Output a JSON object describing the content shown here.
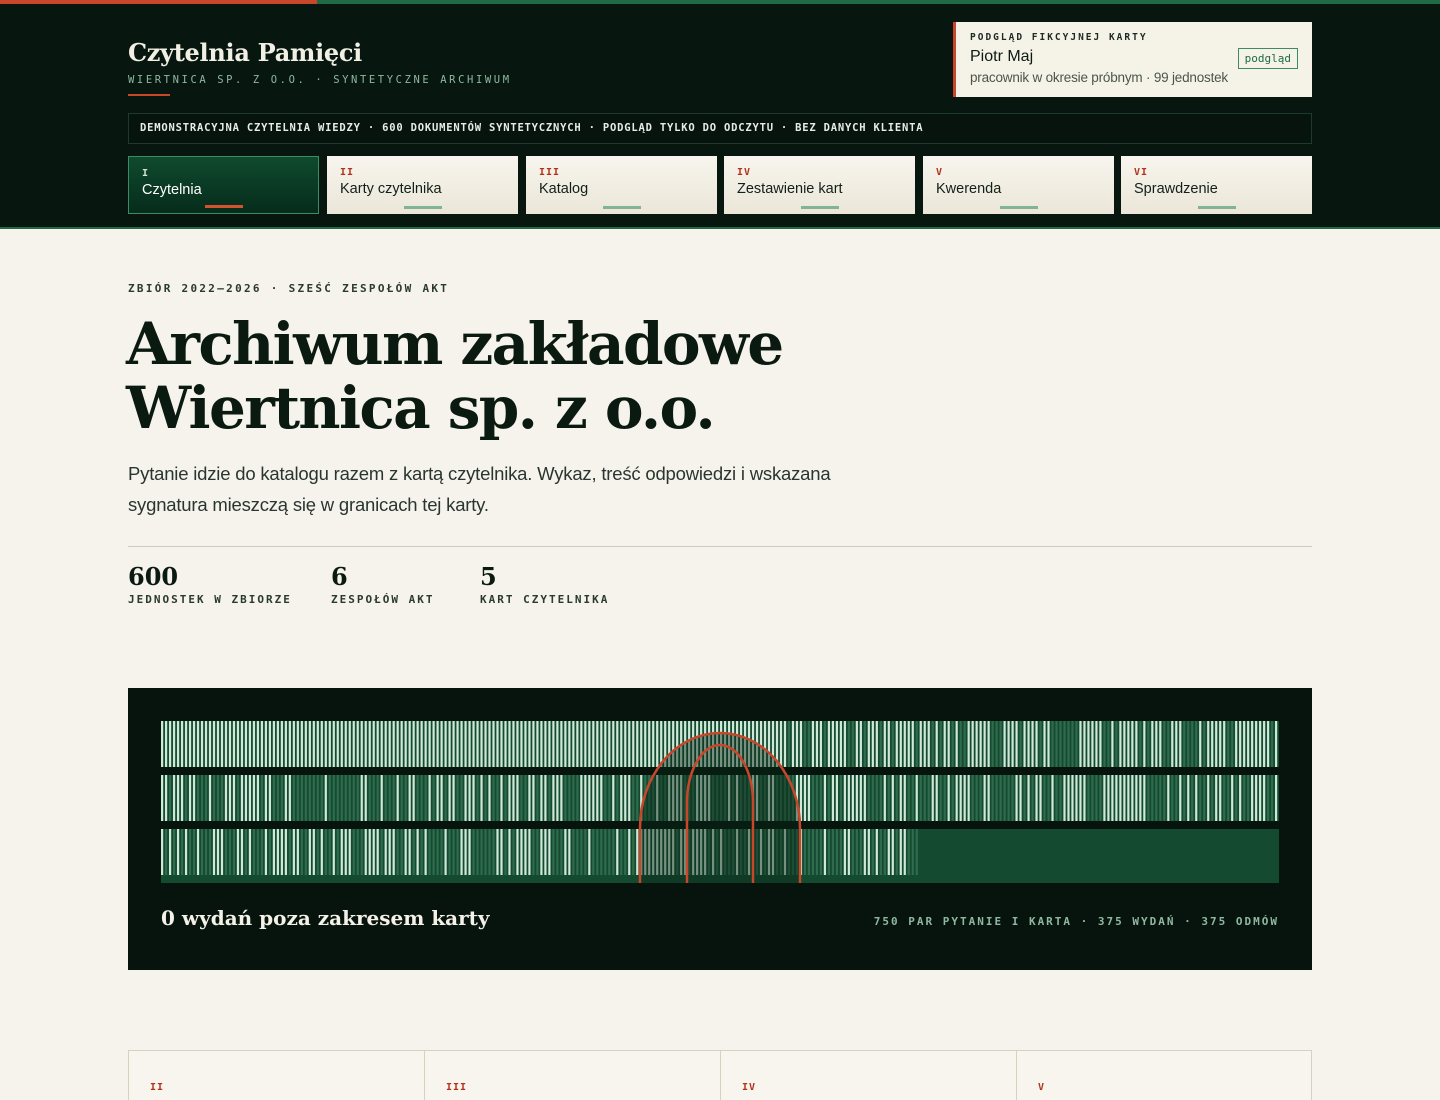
{
  "brand": {
    "title": "Czytelnia Pamięci",
    "subtitle": "WIERTNICA SP. Z O.O. · SYNTETYCZNE ARCHIWUM"
  },
  "card_preview": {
    "heading": "PODGLĄD FIKCYJNEJ KARTY",
    "name": "Piotr Maj",
    "meta": "pracownik w okresie próbnym · 99 jednostek",
    "button_label": "podgląd"
  },
  "ticker": "DEMONSTRACYJNA CZYTELNIA WIEDZY · 600 DOKUMENTÓW SYNTETYCZNYCH · PODGLĄD TYLKO DO ODCZYTU · BEZ DANYCH KLIENTA",
  "tabs": [
    {
      "num": "I",
      "label": "Czytelnia",
      "active": true
    },
    {
      "num": "II",
      "label": "Karty czytelnika",
      "active": false
    },
    {
      "num": "III",
      "label": "Katalog",
      "active": false
    },
    {
      "num": "IV",
      "label": "Zestawienie kart",
      "active": false
    },
    {
      "num": "V",
      "label": "Kwerenda",
      "active": false
    },
    {
      "num": "VI",
      "label": "Sprawdzenie",
      "active": false
    }
  ],
  "hero": {
    "eyebrow": "ZBIÓR 2022–2026 · SZEŚĆ ZESPOŁÓW AKT",
    "title_line1": "Archiwum zakładowe",
    "title_line2": "Wiertnica sp. z o.o.",
    "lede": "Pytanie idzie do katalogu razem z kartą czytelnika. Wykaz, treść odpowiedzi i wskazana sygnatura mieszczą się w granicach tej karty."
  },
  "stats": [
    {
      "value": "600",
      "label": "JEDNOSTEK W ZBIORZE"
    },
    {
      "value": "6",
      "label": "ZESPOŁÓW AKT"
    },
    {
      "value": "5",
      "label": "KART CZYTELNIKA"
    }
  ],
  "visual": {
    "title": "0 wydań poza zakresem karty",
    "meta": "750 PAR PYTANIE I KARTA · 375 WYDAŃ · 375 ODMÓW",
    "pairs": 750,
    "issued": 375,
    "refused": 375,
    "colors": {
      "issued": "#cfe8d8",
      "refused": "#2f6b4c",
      "ring": "#c8462a",
      "band": "#134a30"
    }
  },
  "lower_cards": [
    {
      "num": "II"
    },
    {
      "num": "III"
    },
    {
      "num": "IV"
    },
    {
      "num": "V"
    }
  ]
}
